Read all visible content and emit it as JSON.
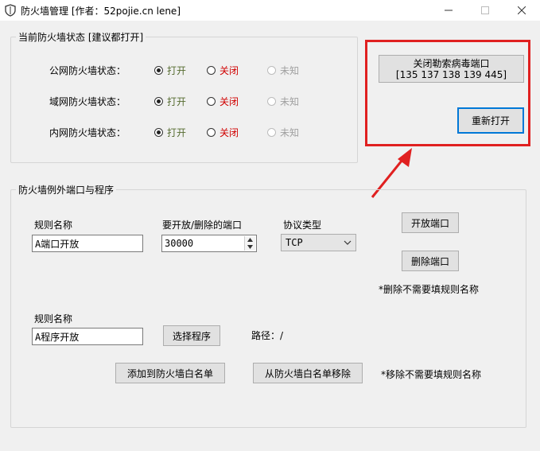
{
  "window": {
    "title": "防火墙管理 [作者：52pojie.cn lene]"
  },
  "status_group": {
    "title": "当前防火墙状态 [建议都打开]",
    "option_on": "打开",
    "option_off": "关闭",
    "option_unknown": "未知",
    "rows": [
      {
        "label": "公网防火墙状态："
      },
      {
        "label": "域网防火墙状态："
      },
      {
        "label": "内网防火墙状态："
      }
    ],
    "colors": {
      "on": "#556b2f",
      "off": "#d00000",
      "unknown": "#a0a0a0"
    }
  },
  "ransomware": {
    "close_button": "关闭勒索病毒端口\n[135 137 138 139 445]",
    "reopen_button": "重新打开"
  },
  "exceptions_group": {
    "title": "防火墙例外端口与程序",
    "rule_name_label": "规则名称",
    "rule_name_value": "A端口开放",
    "port_label": "要开放/删除的端口",
    "port_value": "30000",
    "protocol_label": "协议类型",
    "protocol_value": "TCP",
    "open_port_button": "开放端口",
    "delete_port_button": "删除端口",
    "delete_note": "*删除不需要填规则名称",
    "program_rule_label": "规则名称",
    "program_rule_value": "A程序开放",
    "select_program_button": "选择程序",
    "path_label": "路径：/",
    "add_whitelist_button": "添加到防火墙白名单",
    "remove_whitelist_button": "从防火墙白名单移除",
    "remove_note": "*移除不需要填规则名称"
  },
  "annotation": {
    "color": "#e02020"
  }
}
